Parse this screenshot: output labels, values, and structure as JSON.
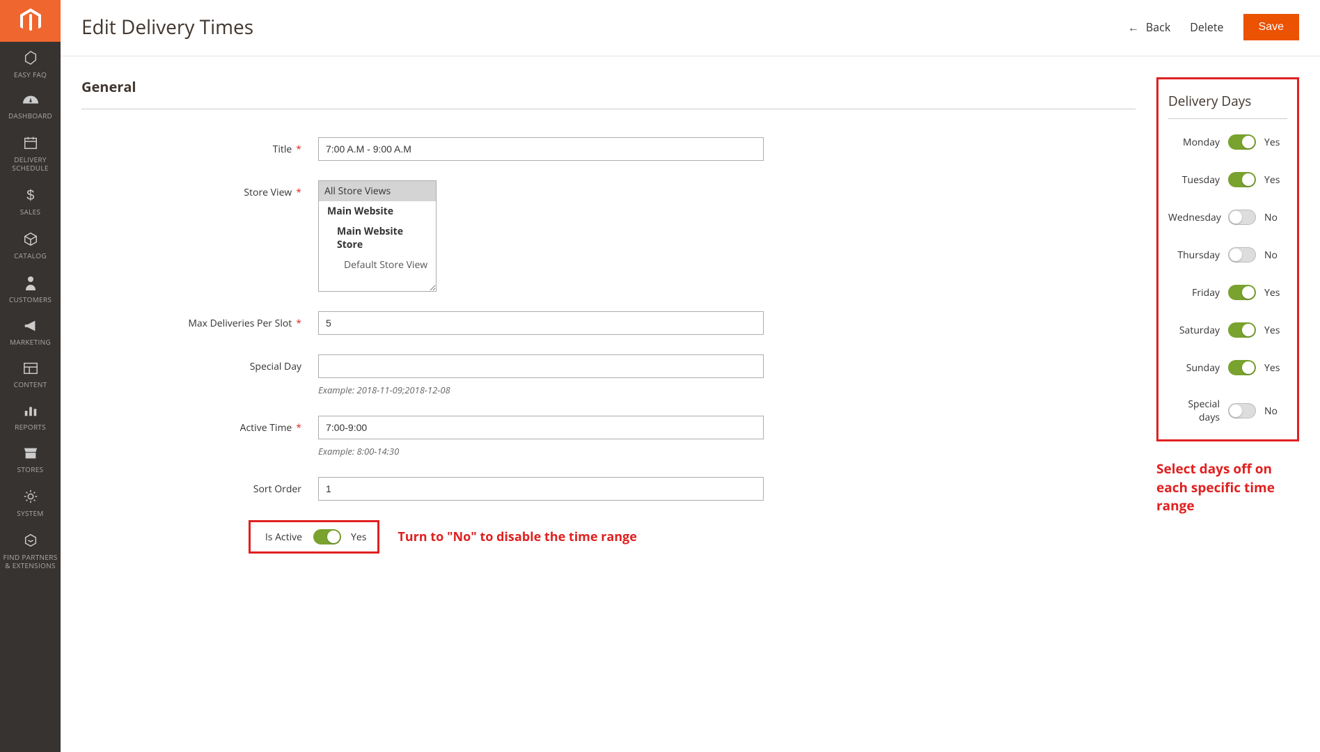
{
  "sidebar": {
    "items": [
      {
        "label": "EASY FAQ"
      },
      {
        "label": "DASHBOARD"
      },
      {
        "label": "DELIVERY SCHEDULE"
      },
      {
        "label": "SALES"
      },
      {
        "label": "CATALOG"
      },
      {
        "label": "CUSTOMERS"
      },
      {
        "label": "MARKETING"
      },
      {
        "label": "CONTENT"
      },
      {
        "label": "REPORTS"
      },
      {
        "label": "STORES"
      },
      {
        "label": "SYSTEM"
      },
      {
        "label": "FIND PARTNERS & EXTENSIONS"
      }
    ]
  },
  "header": {
    "title": "Edit Delivery Times",
    "back": "Back",
    "delete": "Delete",
    "save": "Save"
  },
  "general": {
    "section_title": "General",
    "title_label": "Title",
    "title_value": "7:00 A.M - 9:00 A.M",
    "storeview_label": "Store View",
    "store_options": [
      "All Store Views",
      "Main Website",
      "Main Website Store",
      "Default Store View"
    ],
    "maxdel_label": "Max Deliveries Per Slot",
    "maxdel_value": "5",
    "specialday_label": "Special Day",
    "specialday_value": "",
    "specialday_example": "Example: 2018-11-09;2018-12-08",
    "activetime_label": "Active Time",
    "activetime_value": "7:00-9:00",
    "activetime_example": "Example: 8:00-14:30",
    "sortorder_label": "Sort Order",
    "sortorder_value": "1",
    "isactive_label": "Is Active",
    "isactive_value": "Yes",
    "isactive_on": true
  },
  "delivery_days": {
    "title": "Delivery Days",
    "rows": [
      {
        "label": "Monday",
        "on": true,
        "val": "Yes"
      },
      {
        "label": "Tuesday",
        "on": true,
        "val": "Yes"
      },
      {
        "label": "Wednesday",
        "on": false,
        "val": "No"
      },
      {
        "label": "Thursday",
        "on": false,
        "val": "No"
      },
      {
        "label": "Friday",
        "on": true,
        "val": "Yes"
      },
      {
        "label": "Saturday",
        "on": true,
        "val": "Yes"
      },
      {
        "label": "Sunday",
        "on": true,
        "val": "Yes"
      },
      {
        "label": "Special days",
        "on": false,
        "val": "No"
      }
    ]
  },
  "annotations": {
    "isactive": "Turn to \"No\" to disable the time range",
    "days": "Select days off on each specific time range"
  }
}
